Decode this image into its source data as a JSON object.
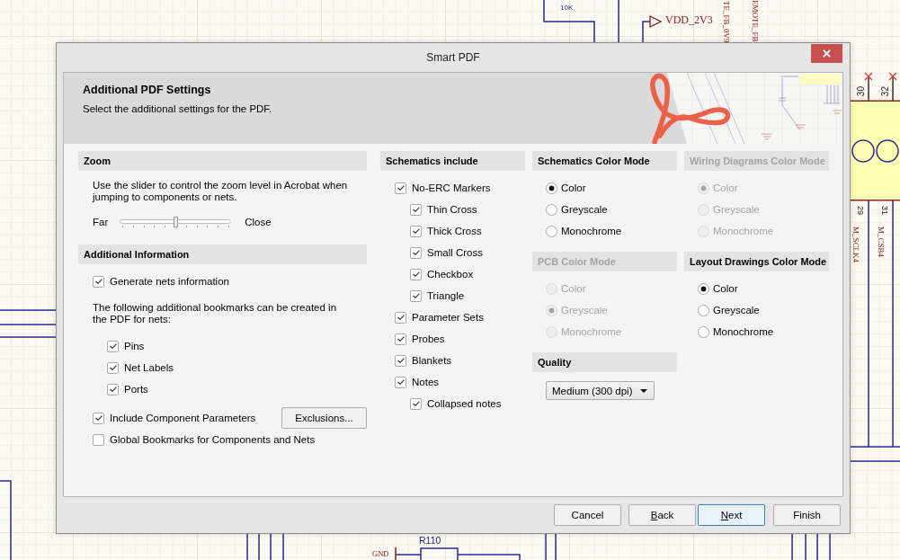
{
  "schematic": {
    "labels": [
      {
        "text": "10K",
        "kind": "value"
      },
      {
        "text": "VDD_2V3",
        "kind": "net"
      },
      {
        "text": "TE_FB_0V9",
        "kind": "net"
      },
      {
        "text": "EMOTE_FB",
        "kind": "net"
      },
      {
        "text": "30",
        "kind": "pin"
      },
      {
        "text": "32",
        "kind": "pin"
      },
      {
        "text": "29",
        "kind": "pin"
      },
      {
        "text": "31",
        "kind": "pin"
      },
      {
        "text": "M_SCLK4",
        "kind": "net"
      },
      {
        "text": "M_CSB4",
        "kind": "net"
      },
      {
        "text": "R110",
        "kind": "designator"
      },
      {
        "text": "GND",
        "kind": "net"
      }
    ]
  },
  "dialog": {
    "title": "Smart PDF",
    "header": {
      "title": "Additional PDF Settings",
      "subtitle": "Select the additional settings for the PDF."
    },
    "zoom": {
      "title": "Zoom",
      "description": "Use the slider to control the zoom level in Acrobat when jumping to components or nets.",
      "far_label": "Far",
      "close_label": "Close",
      "level": 0.5
    },
    "additional_information": {
      "title": "Additional Information",
      "generate_nets": {
        "label": "Generate nets information",
        "checked": true
      },
      "bookmarks_note": "The following additional bookmarks can be created in the PDF for nets:",
      "bookmarks": [
        {
          "label": "Pins",
          "checked": true
        },
        {
          "label": "Net Labels",
          "checked": true
        },
        {
          "label": "Ports",
          "checked": true
        }
      ],
      "component_parameters": {
        "label": "Include Component Parameters",
        "checked": true
      },
      "exclusions_button": "Exclusions...",
      "global_bookmarks": {
        "label": "Global Bookmarks for Components and Nets",
        "checked": false
      }
    },
    "schematics_include": {
      "title": "Schematics include",
      "items": [
        {
          "label": "No-ERC Markers",
          "checked": true,
          "children": [
            {
              "label": "Thin Cross",
              "checked": true
            },
            {
              "label": "Thick Cross",
              "checked": true
            },
            {
              "label": "Small Cross",
              "checked": true
            },
            {
              "label": "Checkbox",
              "checked": true
            },
            {
              "label": "Triangle",
              "checked": true
            }
          ]
        },
        {
          "label": "Parameter Sets",
          "checked": true
        },
        {
          "label": "Probes",
          "checked": true
        },
        {
          "label": "Blankets",
          "checked": true
        },
        {
          "label": "Notes",
          "checked": true,
          "children": [
            {
              "label": "Collapsed notes",
              "checked": true
            }
          ]
        }
      ]
    },
    "option_columns": [
      {
        "sections": [
          {
            "kind": "radio_group",
            "title": "Schematics Color Mode",
            "disabled": false,
            "options": [
              {
                "label": "Color",
                "selected": true
              },
              {
                "label": "Greyscale",
                "selected": false
              },
              {
                "label": "Monochrome",
                "selected": false
              }
            ]
          },
          {
            "kind": "radio_group",
            "title": "PCB Color Mode",
            "disabled": true,
            "options": [
              {
                "label": "Color",
                "selected": false
              },
              {
                "label": "Greyscale",
                "selected": true
              },
              {
                "label": "Monochrome",
                "selected": false
              }
            ]
          },
          {
            "kind": "dropdown",
            "title": "Quality",
            "disabled": false,
            "value": "Medium (300 dpi)"
          }
        ]
      },
      {
        "sections": [
          {
            "kind": "radio_group",
            "title": "Wiring Diagrams Color Mode",
            "disabled": true,
            "options": [
              {
                "label": "Color",
                "selected": true
              },
              {
                "label": "Greyscale",
                "selected": false
              },
              {
                "label": "Monochrome",
                "selected": false
              }
            ]
          },
          {
            "kind": "radio_group",
            "title": "Layout Drawings Color Mode",
            "disabled": false,
            "options": [
              {
                "label": "Color",
                "selected": true
              },
              {
                "label": "Greyscale",
                "selected": false
              },
              {
                "label": "Monochrome",
                "selected": false
              }
            ]
          }
        ]
      }
    ],
    "buttons": [
      {
        "label": "Cancel",
        "mnemonic": false,
        "focused": false
      },
      {
        "label": "Back",
        "mnemonic": true,
        "focused": false
      },
      {
        "label": "Next",
        "mnemonic": true,
        "focused": true
      },
      {
        "label": "Finish",
        "mnemonic": false,
        "focused": false
      }
    ]
  }
}
